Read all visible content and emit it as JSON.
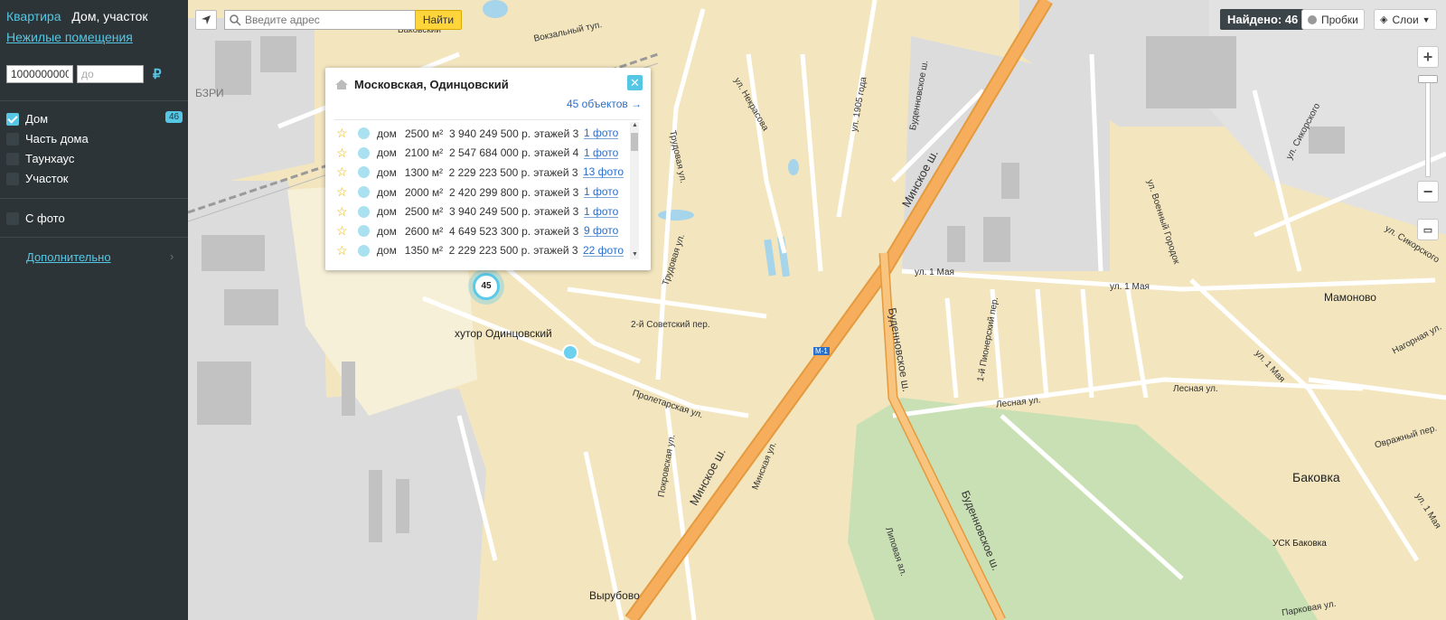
{
  "sidebar": {
    "tab_apartment": "Квартира",
    "tab_house": "Дом, участок",
    "tab_nonresidential": "Нежилые помещения",
    "price_from": "1000000000",
    "price_to_placeholder": "до",
    "currency_icon": "ruble-icon",
    "filters": [
      {
        "label": "Дом",
        "checked": true,
        "count": "46"
      },
      {
        "label": "Часть дома",
        "checked": false
      },
      {
        "label": "Таунхаус",
        "checked": false
      },
      {
        "label": "Участок",
        "checked": false
      }
    ],
    "photo_filter": "С фото",
    "more_label": "Дополнительно"
  },
  "map": {
    "search_placeholder": "Введите адрес",
    "find_label": "Найти",
    "found_label": "Найдено: 46",
    "traffic_label": "Пробки",
    "layers_label": "Слои",
    "cluster_count": "45",
    "street_labels": {
      "minskoe1": "Минское ш.",
      "minskoe2": "Минское ш.",
      "budennovskoe1": "Буденновское ш.",
      "budennovskoe2": "Буденновское ш.",
      "lesnaya": "Лесная ул.",
      "lesnaya2": "Лесная ул.",
      "may1a": "ул. 1 Мая",
      "may1b": "ул. 1 Мая",
      "may1c": "ул. 1 Мая",
      "proletarskaya": "Пролетарская ул.",
      "sovetsky": "2-й Советский пер.",
      "trudovaya": "Трудовая ул.",
      "trudovaya2": "Трудовая ул.",
      "nekrasova": "ул. Некрасова",
      "y1905": "ул. 1905 года",
      "budennovsky_sh": "Буденновское ш.",
      "vokzalny": "Вокзальный туп.",
      "voenny": "ул. Военный Городок",
      "sikorskogo": "ул. Сикорского",
      "sikorskogo2": "ул. Сикорского",
      "pionersky": "1-й Пионерский пер.",
      "pokrovskaya": "Покровская ул.",
      "minskaya": "Минская ул.",
      "lipovaya": "Липовая ал.",
      "nagornaya": "Нагорная ул.",
      "ovrazhny": "Овражный пер.",
      "parkovaya": "Парковая ул.",
      "may1d": "ул. 1 Мая",
      "m1": "М-1",
      "bzri": "БЗРИ",
      "bakovsky": "Баковский"
    },
    "places": {
      "khutor": "хутор Одинцовский",
      "bakovka": "Баковка",
      "mamonovo": "Мамоново",
      "vyrubovo": "Вырубово",
      "usk": "УСК Баковка"
    }
  },
  "popup": {
    "title": "Московская, Одинцовский",
    "count_link": "45 объектов →",
    "listings": [
      {
        "type": "дом",
        "area": "2500 м²",
        "price": "3 940 249 500 р.",
        "floors": "этажей 3",
        "photos": "1 фото"
      },
      {
        "type": "дом",
        "area": "2100 м²",
        "price": "2 547 684 000 р.",
        "floors": "этажей 4",
        "photos": "1 фото"
      },
      {
        "type": "дом",
        "area": "1300 м²",
        "price": "2 229 223 500 р.",
        "floors": "этажей 3",
        "photos": "13 фото"
      },
      {
        "type": "дом",
        "area": "2000 м²",
        "price": "2 420 299 800 р.",
        "floors": "этажей 3",
        "photos": "1 фото"
      },
      {
        "type": "дом",
        "area": "2500 м²",
        "price": "3 940 249 500 р.",
        "floors": "этажей 3",
        "photos": "1 фото"
      },
      {
        "type": "дом",
        "area": "2600 м²",
        "price": "4 649 523 300 р.",
        "floors": "этажей 3",
        "photos": "9 фото"
      },
      {
        "type": "дом",
        "area": "1350 м²",
        "price": "2 229 223 500 р.",
        "floors": "этажей 3",
        "photos": "22 фото"
      }
    ]
  },
  "colors": {
    "sidebar_bg": "#2c3438",
    "accent": "#55c6e3",
    "map_bg": "#f3e6bf",
    "road_major": "#f6ae5c",
    "industrial": "#dcdcdc",
    "park": "#c9e0b5",
    "water": "#a6d4ea"
  }
}
